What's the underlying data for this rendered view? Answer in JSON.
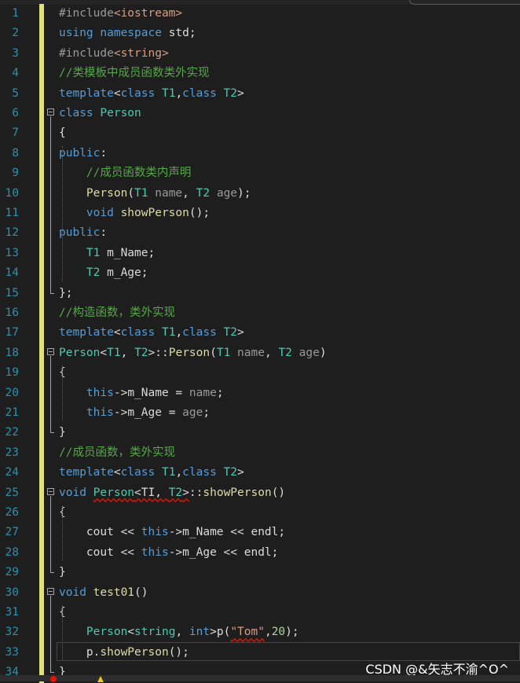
{
  "editor": {
    "lines": [
      {
        "num": "1",
        "tokens": [
          [
            "pp",
            "#include"
          ],
          [
            "inc",
            "<iostream>"
          ]
        ]
      },
      {
        "num": "2",
        "tokens": [
          [
            "kw",
            "using"
          ],
          [
            "plain",
            " "
          ],
          [
            "kw",
            "namespace"
          ],
          [
            "plain",
            " std;"
          ]
        ]
      },
      {
        "num": "3",
        "tokens": [
          [
            "pp",
            "#include"
          ],
          [
            "inc",
            "<string>"
          ]
        ]
      },
      {
        "num": "4",
        "tokens": [
          [
            "cm",
            "//类模板中成员函数类外实现"
          ]
        ]
      },
      {
        "num": "5",
        "tokens": [
          [
            "kw",
            "template"
          ],
          [
            "plain",
            "<"
          ],
          [
            "kw",
            "class"
          ],
          [
            "type",
            " T1"
          ],
          [
            "plain",
            ","
          ],
          [
            "kw",
            "class"
          ],
          [
            "type",
            " T2"
          ],
          [
            "plain",
            ">"
          ]
        ]
      },
      {
        "num": "6",
        "tokens": [
          [
            "kw",
            "class"
          ],
          [
            "plain",
            " "
          ],
          [
            "type",
            "Person"
          ]
        ]
      },
      {
        "num": "7",
        "tokens": [
          [
            "plain",
            "{"
          ]
        ]
      },
      {
        "num": "8",
        "tokens": [
          [
            "kw",
            "public"
          ],
          [
            "plain",
            ":"
          ]
        ]
      },
      {
        "num": "9",
        "tokens": [
          [
            "plain",
            "    "
          ],
          [
            "cm",
            "//成员函数类内声明"
          ]
        ]
      },
      {
        "num": "10",
        "tokens": [
          [
            "plain",
            "    "
          ],
          [
            "fn",
            "Person"
          ],
          [
            "plain",
            "("
          ],
          [
            "type",
            "T1"
          ],
          [
            "param",
            " name"
          ],
          [
            "plain",
            ", "
          ],
          [
            "type",
            "T2"
          ],
          [
            "param",
            " age"
          ],
          [
            "plain",
            ");"
          ]
        ]
      },
      {
        "num": "11",
        "tokens": [
          [
            "plain",
            "    "
          ],
          [
            "kw",
            "void"
          ],
          [
            "plain",
            " "
          ],
          [
            "fn",
            "showPerson"
          ],
          [
            "plain",
            "();"
          ]
        ]
      },
      {
        "num": "12",
        "tokens": [
          [
            "kw",
            "public"
          ],
          [
            "plain",
            ":"
          ]
        ]
      },
      {
        "num": "13",
        "tokens": [
          [
            "plain",
            "    "
          ],
          [
            "type",
            "T1"
          ],
          [
            "mem",
            " m_Name"
          ],
          [
            "plain",
            ";"
          ]
        ]
      },
      {
        "num": "14",
        "tokens": [
          [
            "plain",
            "    "
          ],
          [
            "type",
            "T2"
          ],
          [
            "mem",
            " m_Age"
          ],
          [
            "plain",
            ";"
          ]
        ]
      },
      {
        "num": "15",
        "tokens": [
          [
            "plain",
            "};"
          ]
        ]
      },
      {
        "num": "16",
        "tokens": [
          [
            "cm",
            "//构造函数，类外实现"
          ]
        ]
      },
      {
        "num": "17",
        "tokens": [
          [
            "kw",
            "template"
          ],
          [
            "plain",
            "<"
          ],
          [
            "kw",
            "class"
          ],
          [
            "type",
            " T1"
          ],
          [
            "plain",
            ","
          ],
          [
            "kw",
            "class"
          ],
          [
            "type",
            " T2"
          ],
          [
            "plain",
            ">"
          ]
        ]
      },
      {
        "num": "18",
        "tokens": [
          [
            "type",
            "Person"
          ],
          [
            "plain",
            "<"
          ],
          [
            "type",
            "T1"
          ],
          [
            "plain",
            ", "
          ],
          [
            "type",
            "T2"
          ],
          [
            "plain",
            ">::"
          ],
          [
            "fn",
            "Person"
          ],
          [
            "plain",
            "("
          ],
          [
            "type",
            "T1"
          ],
          [
            "param",
            " name"
          ],
          [
            "plain",
            ", "
          ],
          [
            "type",
            "T2"
          ],
          [
            "param",
            " age"
          ],
          [
            "plain",
            ")"
          ]
        ]
      },
      {
        "num": "19",
        "tokens": [
          [
            "plain",
            "{"
          ]
        ]
      },
      {
        "num": "20",
        "tokens": [
          [
            "plain",
            "    "
          ],
          [
            "kw",
            "this"
          ],
          [
            "plain",
            "->"
          ],
          [
            "mem",
            "m_Name"
          ],
          [
            "plain",
            " = "
          ],
          [
            "param",
            "name"
          ],
          [
            "plain",
            ";"
          ]
        ]
      },
      {
        "num": "21",
        "tokens": [
          [
            "plain",
            "    "
          ],
          [
            "kw",
            "this"
          ],
          [
            "plain",
            "->"
          ],
          [
            "mem",
            "m_Age"
          ],
          [
            "plain",
            " = "
          ],
          [
            "param",
            "age"
          ],
          [
            "plain",
            ";"
          ]
        ]
      },
      {
        "num": "22",
        "tokens": [
          [
            "plain",
            "}"
          ]
        ]
      },
      {
        "num": "23",
        "tokens": [
          [
            "cm",
            "//成员函数，类外实现"
          ]
        ]
      },
      {
        "num": "24",
        "tokens": [
          [
            "kw",
            "template"
          ],
          [
            "plain",
            "<"
          ],
          [
            "kw",
            "class"
          ],
          [
            "type",
            " T1"
          ],
          [
            "plain",
            ","
          ],
          [
            "kw",
            "class"
          ],
          [
            "type",
            " T2"
          ],
          [
            "plain",
            ">"
          ]
        ]
      },
      {
        "num": "25",
        "tokens": [
          [
            "kw",
            "void"
          ],
          [
            "plain",
            " "
          ],
          [
            "type squig",
            "Person"
          ],
          [
            "plain squig",
            "<TI, "
          ],
          [
            "type squig",
            "T2"
          ],
          [
            "plain squig",
            ">"
          ],
          [
            "plain",
            "::"
          ],
          [
            "fn",
            "showPerson"
          ],
          [
            "plain",
            "()"
          ]
        ]
      },
      {
        "num": "26",
        "tokens": [
          [
            "plain",
            "{"
          ]
        ]
      },
      {
        "num": "27",
        "tokens": [
          [
            "plain",
            "    cout << "
          ],
          [
            "kw",
            "this"
          ],
          [
            "plain",
            "->"
          ],
          [
            "mem",
            "m_Name"
          ],
          [
            "plain",
            " << endl;"
          ]
        ]
      },
      {
        "num": "28",
        "tokens": [
          [
            "plain",
            "    cout << "
          ],
          [
            "kw",
            "this"
          ],
          [
            "plain",
            "->"
          ],
          [
            "mem",
            "m_Age"
          ],
          [
            "plain",
            " << endl;"
          ]
        ]
      },
      {
        "num": "29",
        "tokens": [
          [
            "plain",
            "}"
          ]
        ]
      },
      {
        "num": "30",
        "tokens": [
          [
            "kw",
            "void"
          ],
          [
            "plain",
            " "
          ],
          [
            "fn",
            "test01"
          ],
          [
            "plain",
            "()"
          ]
        ]
      },
      {
        "num": "31",
        "tokens": [
          [
            "plain",
            "{"
          ]
        ]
      },
      {
        "num": "32",
        "tokens": [
          [
            "plain",
            "    "
          ],
          [
            "type",
            "Person"
          ],
          [
            "plain",
            "<"
          ],
          [
            "type",
            "string"
          ],
          [
            "plain",
            ", "
          ],
          [
            "kw",
            "int"
          ],
          [
            "plain",
            ">p("
          ],
          [
            "str squig",
            "\"Tom\""
          ],
          [
            "plain",
            ","
          ],
          [
            "num",
            "20"
          ],
          [
            "plain",
            ");"
          ]
        ]
      },
      {
        "num": "33",
        "tokens": [
          [
            "plain",
            "    p."
          ],
          [
            "fn",
            "showPerson"
          ],
          [
            "plain",
            "();"
          ]
        ]
      },
      {
        "num": "34",
        "tokens": [
          [
            "plain",
            "}"
          ]
        ]
      }
    ]
  },
  "watermark": "CSDN @&矢志不渝^O^",
  "colors": {
    "background": "#1e1e1e",
    "line_number": "#2b91af",
    "keyword": "#569cd6",
    "type": "#4ec9b0",
    "function": "#dcdcaa",
    "comment": "#57a64a",
    "string": "#d69d85",
    "change_marker": "#e1e17a"
  }
}
